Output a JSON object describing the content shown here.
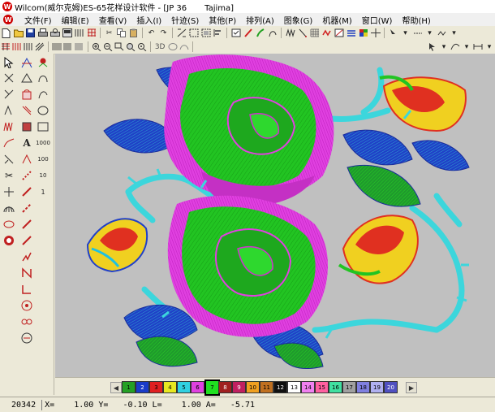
{
  "window": {
    "title_main": "Wilcom(威尔克姆)ES-65花样设计软件 - [JP 36",
    "title_machine": "Tajima]"
  },
  "menu": [
    {
      "label": "文件(F)"
    },
    {
      "label": "编辑(E)"
    },
    {
      "label": "查看(V)"
    },
    {
      "label": "插入(I)"
    },
    {
      "label": "针迹(S)"
    },
    {
      "label": "其他(P)"
    },
    {
      "label": "排列(A)"
    },
    {
      "label": "图象(G)"
    },
    {
      "label": "机器(M)"
    },
    {
      "label": "窗口(W)"
    },
    {
      "label": "帮助(H)"
    }
  ],
  "toolbar": {
    "view_3d_label": "3D"
  },
  "left_tools": {
    "count_1000": "1000",
    "count_100": "100",
    "count_10": "10",
    "count_1": "1"
  },
  "palette": {
    "selected": "7",
    "colors": [
      {
        "num": "1",
        "hex": "#24a024"
      },
      {
        "num": "2",
        "hex": "#1a3cc8"
      },
      {
        "num": "3",
        "hex": "#e02020"
      },
      {
        "num": "4",
        "hex": "#e8e820"
      },
      {
        "num": "5",
        "hex": "#30d0e0"
      },
      {
        "num": "6",
        "hex": "#e040e0"
      },
      {
        "num": "7",
        "hex": "#20e020"
      },
      {
        "num": "8",
        "hex": "#a02020"
      },
      {
        "num": "9",
        "hex": "#c02060"
      },
      {
        "num": "10",
        "hex": "#f0a020"
      },
      {
        "num": "11",
        "hex": "#c07020"
      },
      {
        "num": "12",
        "hex": "#101010"
      },
      {
        "num": "13",
        "hex": "#ffffff"
      },
      {
        "num": "14",
        "hex": "#f080f0"
      },
      {
        "num": "15",
        "hex": "#ff60a0"
      },
      {
        "num": "16",
        "hex": "#40e0a0"
      },
      {
        "num": "17",
        "hex": "#a0a0a0"
      },
      {
        "num": "18",
        "hex": "#8080e0"
      },
      {
        "num": "19",
        "hex": "#b0b0f0"
      },
      {
        "num": "20",
        "hex": "#5050c0"
      }
    ]
  },
  "status": {
    "stitch_count": "20342",
    "coords": "X=    1.00 Y=   -0.10 L=    1.00 A=   -5.71"
  },
  "colors": {
    "leaf_blue": "#1f3ec8",
    "leaf_green": "#22c422",
    "petal_magenta": "#e040e0",
    "stem_cyan": "#3cd6dc",
    "bud_red": "#e03020",
    "bud_yellow": "#f0d020"
  }
}
